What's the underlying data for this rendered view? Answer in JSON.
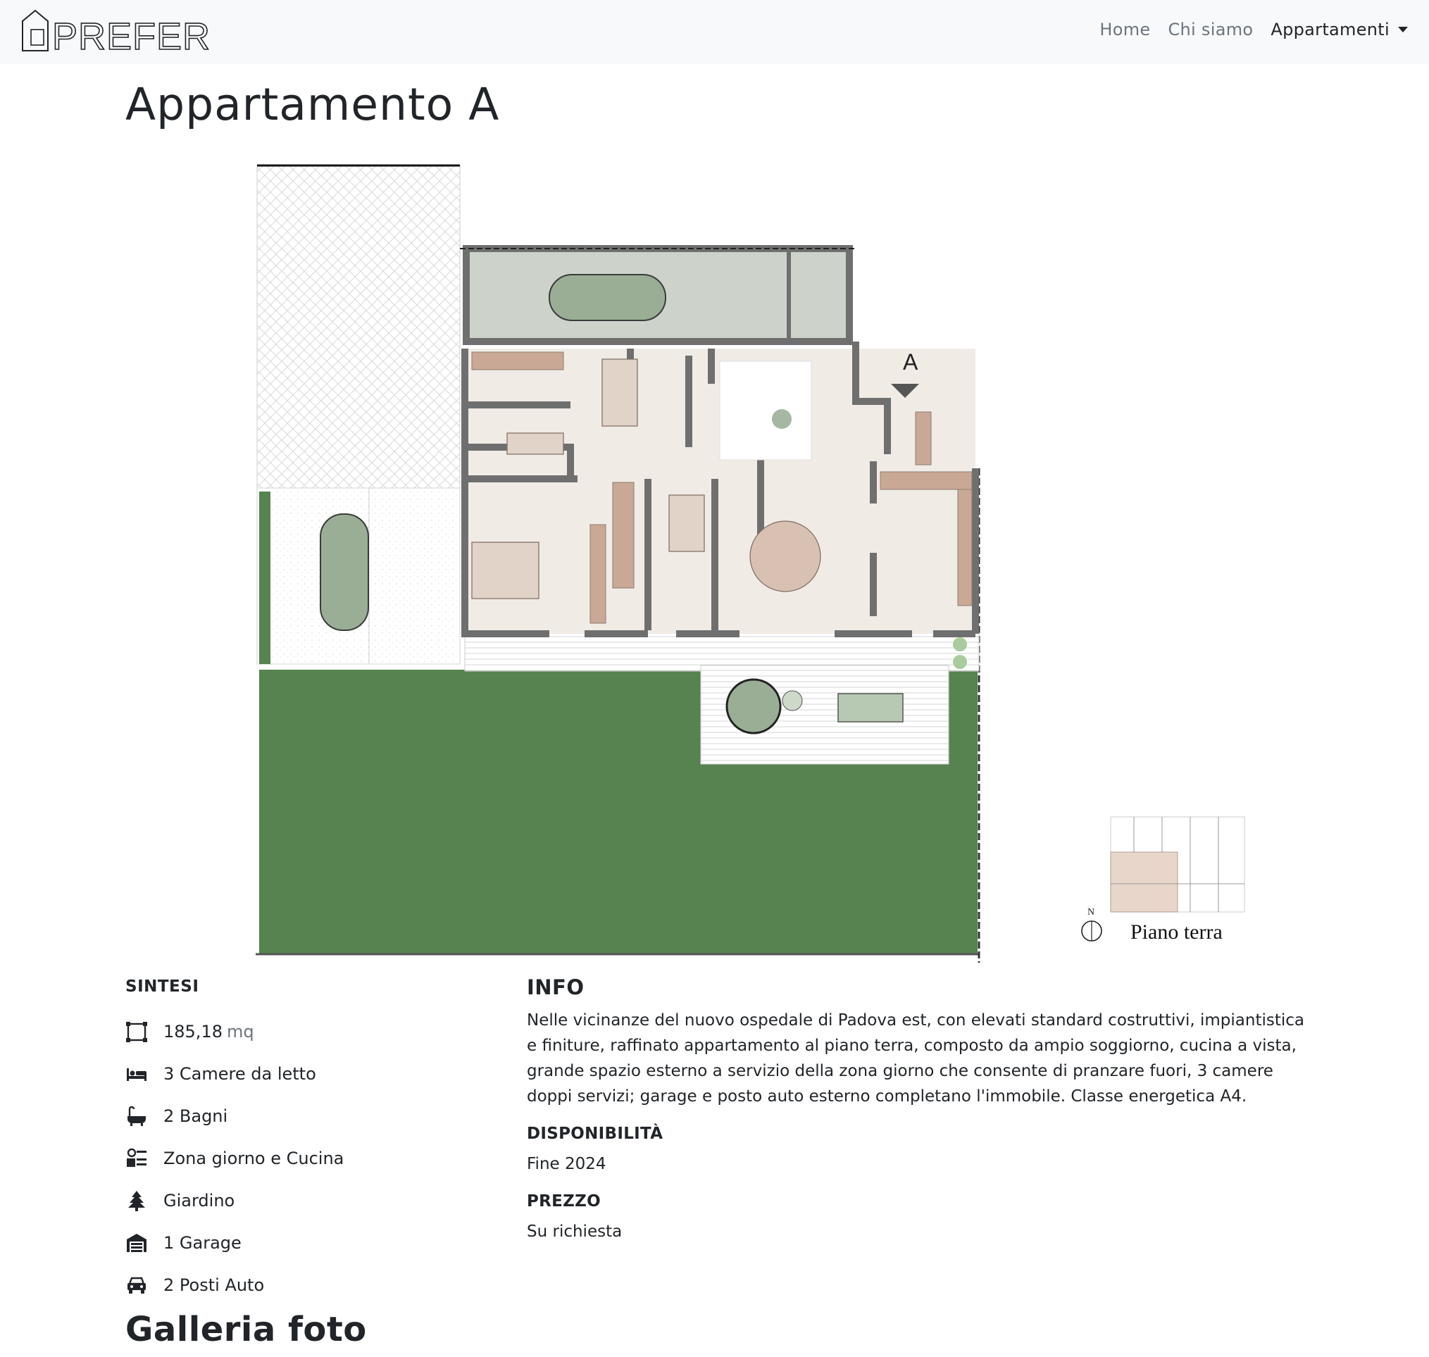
{
  "brand": {
    "logo_text": "PREFER"
  },
  "nav": {
    "home": "Home",
    "about": "Chi siamo",
    "apartments": "Appartamenti"
  },
  "page": {
    "title": "Appartamento A"
  },
  "plan": {
    "section_marker": "A",
    "north_label": "N",
    "floor_label": "Piano terra"
  },
  "sintesi": {
    "title": "SINTESI",
    "area_value": "185,18",
    "area_unit": "mq",
    "bedrooms": "3 Camere da letto",
    "bathrooms": "2 Bagni",
    "living": "Zona giorno e Cucina",
    "garden": "Giardino",
    "garage": "1 Garage",
    "parking": "2 Posti Auto"
  },
  "info": {
    "title": "INFO",
    "description": "Nelle vicinanze del nuovo ospedale di Padova est, con elevati standard costruttivi, impiantistica e finiture, raffinato appartamento al piano terra, composto da ampio soggiorno, cucina a vista, grande spazio esterno a servizio della zona giorno che consente di pranzare fuori, 3 camere doppi servizi; garage e posto auto esterno completano l'immobile. Classe energetica A4.",
    "availability_title": "DISPONIBILITÀ",
    "availability_value": "Fine 2024",
    "price_title": "PREZZO",
    "price_value": "Su richiesta"
  },
  "gallery": {
    "title": "Galleria foto"
  },
  "colors": {
    "lawn": "#56834f",
    "floor": "#f1ebe6",
    "walls": "#6f6f6f",
    "garage": "#cdd2cb",
    "car": "#9aae96",
    "wood": "#c9a896"
  }
}
